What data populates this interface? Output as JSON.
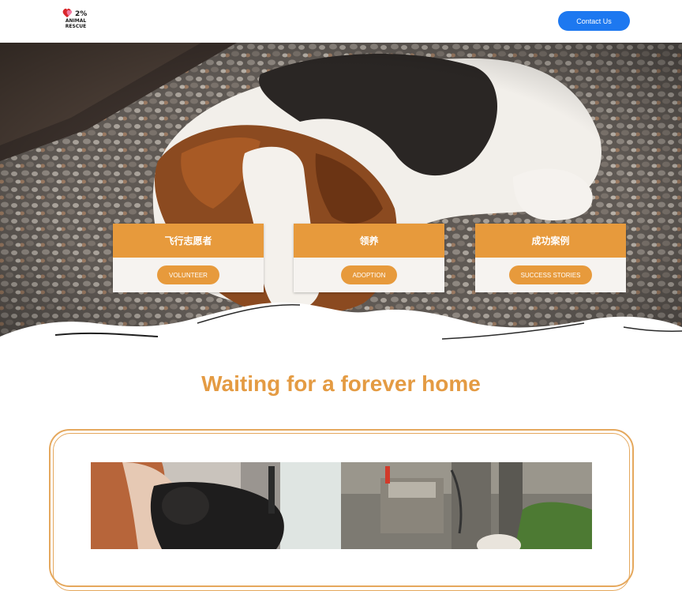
{
  "header": {
    "logo": {
      "percent": "2%",
      "line1": "ANIMAL",
      "line2": "RESCUE"
    },
    "contact_label": "Contact Us"
  },
  "cards": [
    {
      "title": "飞行志愿者",
      "button": "VOLUNTEER"
    },
    {
      "title": "领养",
      "button": "ADOPTION"
    },
    {
      "title": "成功案例",
      "button": "SUCCESS STORIES"
    }
  ],
  "section": {
    "title": "Waiting for a forever home"
  },
  "colors": {
    "accent_orange": "#e79a3c",
    "contact_blue": "#1d78f0",
    "card_body": "#f6f3f0"
  },
  "images": {
    "hero": "beagle-puppy-on-gravel",
    "gallery_left": "person-holding-black-puppy",
    "gallery_right": "dog-in-concrete-yard"
  }
}
